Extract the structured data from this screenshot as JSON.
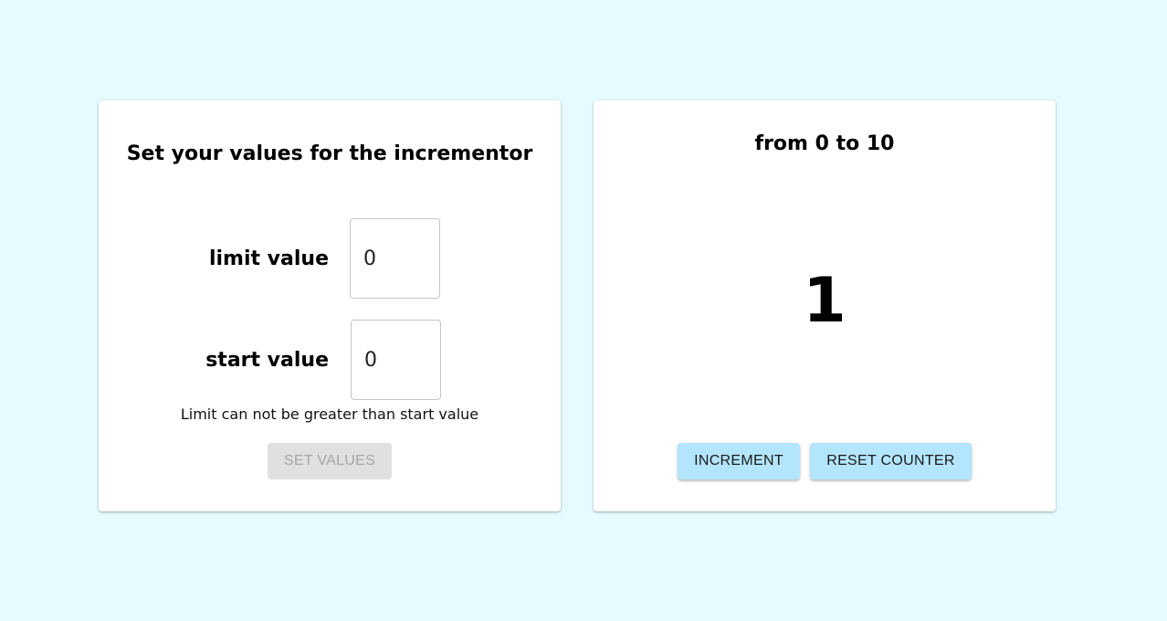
{
  "settings": {
    "title": "Set your values for the incrementor",
    "limit_label": "limit value",
    "limit_value": "0",
    "start_label": "start value",
    "start_value": "0",
    "error_message": "Limit can not be greater than start value",
    "set_button_label": "SET VALUES"
  },
  "counter": {
    "range_text": "from 0 to 10",
    "value": "1",
    "increment_label": "INCREMENT",
    "reset_label": "RESET COUNTER"
  },
  "colors": {
    "background": "#e6fbff",
    "card": "#ffffff",
    "button_active": "#b3e5fc",
    "button_disabled": "#e0e0e0"
  }
}
